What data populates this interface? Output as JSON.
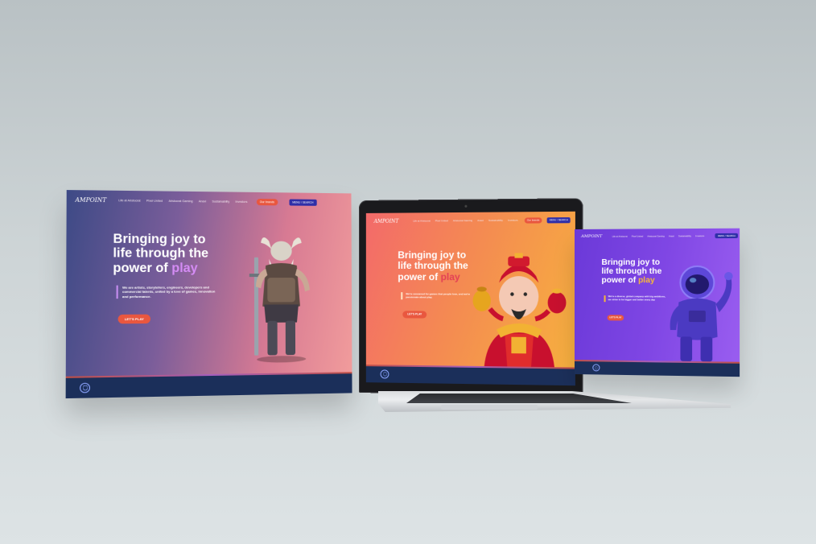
{
  "brand": {
    "logo_text": "AMPOINT"
  },
  "nav": {
    "items": [
      "Life at Aristocrat",
      "Pixel United",
      "Aristocrat Gaming",
      "Anaxi",
      "Sustainability",
      "Investors"
    ],
    "cta_label": "Our brands",
    "menu_label": "MENU / SEARCH"
  },
  "hero": {
    "headline_line1": "Bringing joy to",
    "headline_line2": "life through the",
    "headline_line3": "power of",
    "headline_accent": "play",
    "tagline_left": "We are artists, storytellers, engineers, developers and commercial talents, united by a love of games, innovation and performance.",
    "tagline_center": "We're renowned for games that people love, and we're passionate about play.",
    "tagline_right": "We're a diverse, global company with big ambitions, we strive to be bigger and better every day",
    "button_label": "LET'S PLAY"
  },
  "colors": {
    "accent_orange": "#e9573f",
    "accent_violet": "#d58cf5",
    "footer_navy": "#1b2f5a",
    "nav_blue": "#2f2fa8"
  },
  "icons": {
    "footer": "shield-icon",
    "camera": "webcam-icon"
  }
}
